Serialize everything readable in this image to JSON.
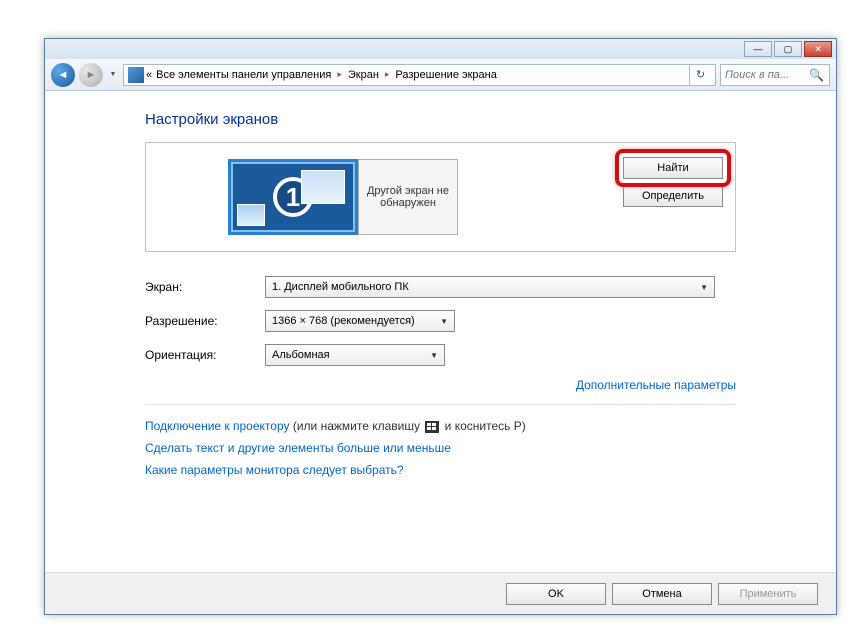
{
  "titlebar": {
    "min": "—",
    "max": "▢",
    "close": "✕"
  },
  "breadcrumb": {
    "chevron_left": "«",
    "item1": "Все элементы панели управления",
    "item2": "Экран",
    "item3": "Разрешение экрана"
  },
  "search": {
    "placeholder": "Поиск в па..."
  },
  "page": {
    "title": "Настройки экранов"
  },
  "display": {
    "monitor_number": "1",
    "other_text": "Другой экран не обнаружен",
    "find_btn": "Найти",
    "identify_btn": "Определить"
  },
  "form": {
    "screen_label": "Экран:",
    "screen_value": "1. Дисплей мобильного ПК",
    "resolution_label": "Разрешение:",
    "resolution_value": "1366 × 768 (рекомендуется)",
    "orientation_label": "Ориентация:",
    "orientation_value": "Альбомная"
  },
  "links": {
    "advanced": "Дополнительные параметры",
    "projector_link": "Подключение к проектору",
    "projector_text_a": " (или нажмите клавишу ",
    "projector_text_b": " и коснитесь P)",
    "text_size": "Сделать текст и другие элементы больше или меньше",
    "which_monitor": "Какие параметры монитора следует выбрать?"
  },
  "buttons": {
    "ok": "OK",
    "cancel": "Отмена",
    "apply": "Применить"
  }
}
